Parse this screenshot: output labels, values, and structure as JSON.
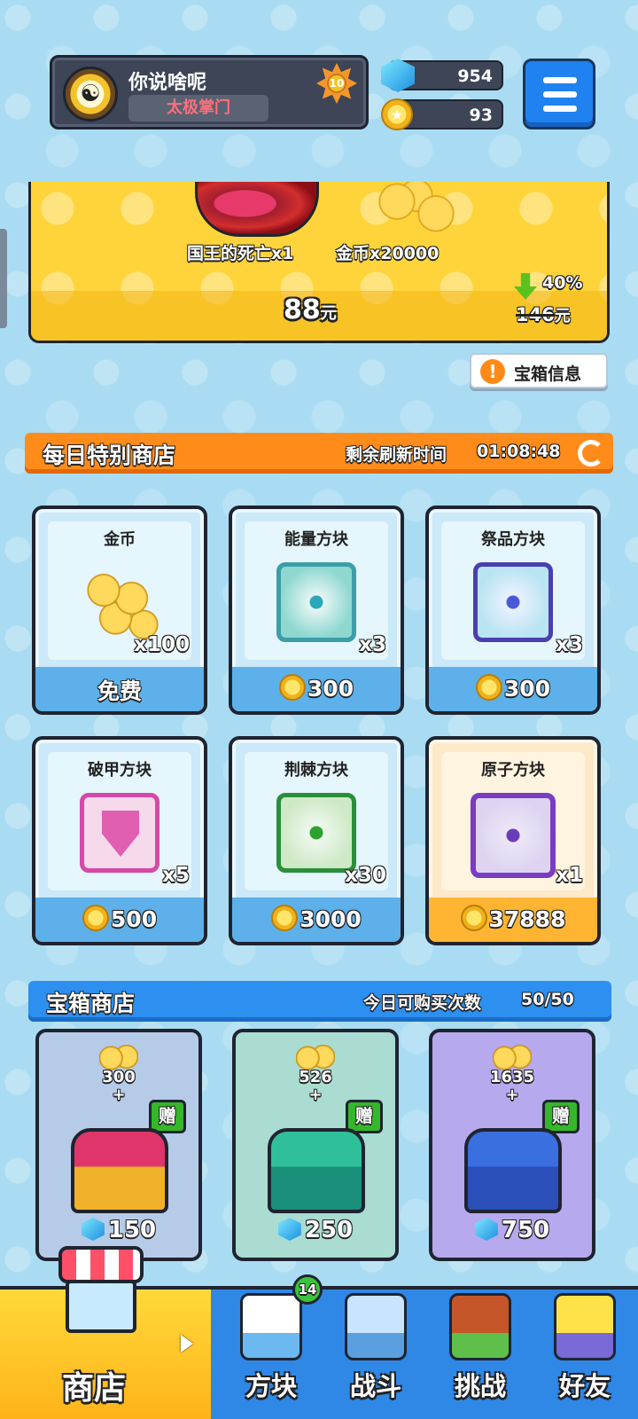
{
  "player": {
    "name": "你说啥呢",
    "title": "太极掌门",
    "level": "10",
    "gems": "954",
    "coins": "93"
  },
  "promo": {
    "reward1": "国王的死亡x1",
    "reward2": "金币x20000",
    "price": "88",
    "price_unit": "元",
    "discount": "40%",
    "old_price": "146",
    "old_price_unit": "元",
    "info_label": "宝箱信息"
  },
  "daily_shop": {
    "title": "每日特别商店",
    "refresh_label": "剩余刷新时间",
    "refresh_time": "01:08:48",
    "items": [
      {
        "name": "金币",
        "qty": "x100",
        "price": "免费",
        "icon": "coin-pile-icon"
      },
      {
        "name": "能量方块",
        "qty": "x3",
        "price": "300",
        "icon": "energy-dice-icon"
      },
      {
        "name": "祭品方块",
        "qty": "x3",
        "price": "300",
        "icon": "offering-dice-icon"
      },
      {
        "name": "破甲方块",
        "qty": "x5",
        "price": "500",
        "icon": "armor-break-dice-icon"
      },
      {
        "name": "荆棘方块",
        "qty": "x30",
        "price": "3000",
        "icon": "thorn-dice-icon"
      },
      {
        "name": "原子方块",
        "qty": "x1",
        "price": "37888",
        "icon": "atom-dice-icon"
      }
    ]
  },
  "chest_shop": {
    "title": "宝箱商店",
    "limit_label": "今日可购买次数",
    "limit_value": "50/50",
    "gift_label": "赠",
    "chests": [
      {
        "coins": "300",
        "plus": "+",
        "price": "150",
        "color": "#e0356a"
      },
      {
        "coins": "526",
        "plus": "+",
        "price": "250",
        "color": "#2fc09a"
      },
      {
        "coins": "1635",
        "plus": "+",
        "price": "750",
        "color": "#3a6fe0"
      }
    ]
  },
  "nav": {
    "shop": "商店",
    "dice": "方块",
    "battle": "战斗",
    "challenge": "挑战",
    "friends": "好友",
    "dice_badge": "14"
  },
  "colors": {
    "background": "#a9dcf2",
    "daily_header": "#ff8c1a",
    "chest_header": "#2d8ff0",
    "nav": "#2f87e6",
    "nav_active": "#ffc52a"
  }
}
